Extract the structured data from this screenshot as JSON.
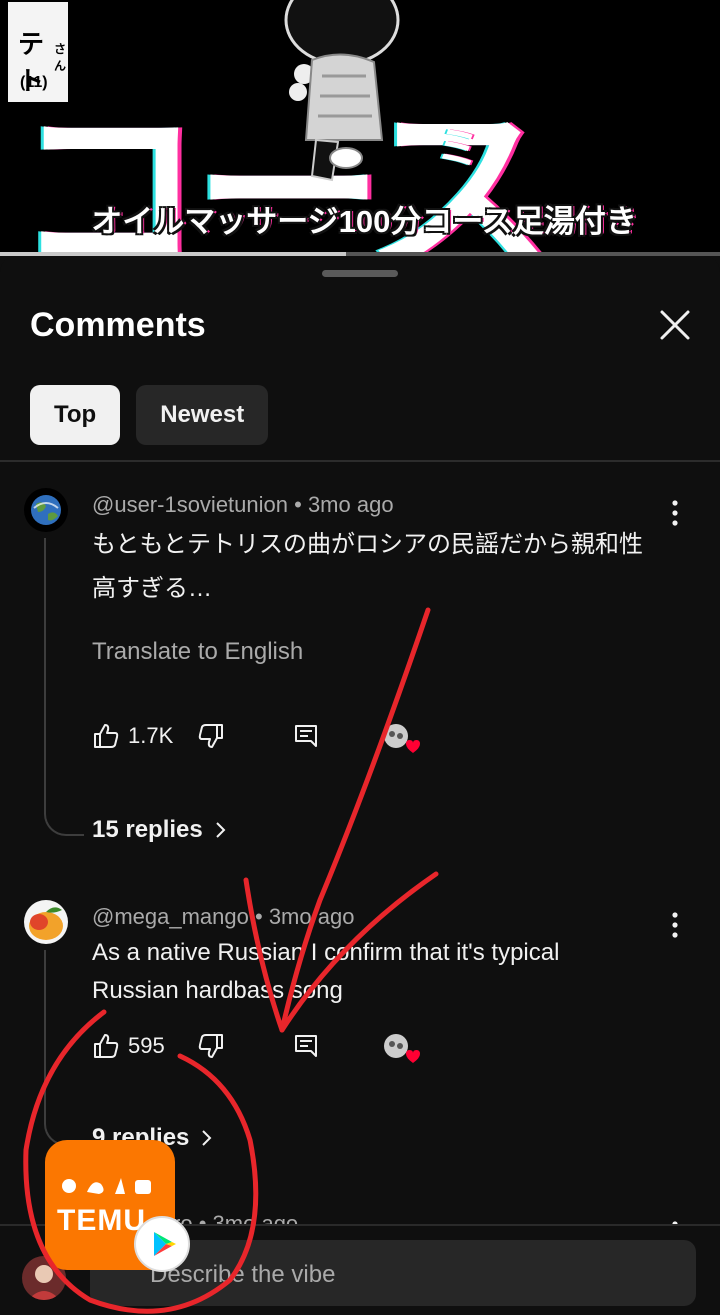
{
  "video": {
    "tag_kana": "テト",
    "tag_san": "さん",
    "tag_num": "(11)",
    "big_text": "コース",
    "small_text": "ミ",
    "subtitle": "オイルマッサージ100分コース足湯付き",
    "progress": 0.48
  },
  "sheet": {
    "title": "Comments",
    "chips": [
      {
        "label": "Top",
        "active": true
      },
      {
        "label": "Newest",
        "active": false
      }
    ]
  },
  "comments": [
    {
      "author": "@user-1sovietunion",
      "time": "3mo ago",
      "text_line1": "もともとテトリスの曲がロシアの民謡だから親和性",
      "text_line2": "高すぎる…",
      "translate": "Translate to English",
      "likes": "1.7K",
      "replies": "15 replies"
    },
    {
      "author": "@mega_mango",
      "time": "3mo ago",
      "text_line1": "As a native Russian I confirm that it's typical",
      "text_line2": "Russian hardbass song",
      "likes": "595",
      "replies": "9 replies"
    },
    {
      "author": "@chakuro",
      "time": "3mo ago"
    }
  ],
  "input": {
    "placeholder": "Describe the vibe"
  },
  "ad": {
    "brand": "TEMU",
    "color": "#fb7701"
  },
  "colors": {
    "background": "#0f0f0f",
    "annotation": "#e8262b",
    "heart": "#ff0033"
  }
}
